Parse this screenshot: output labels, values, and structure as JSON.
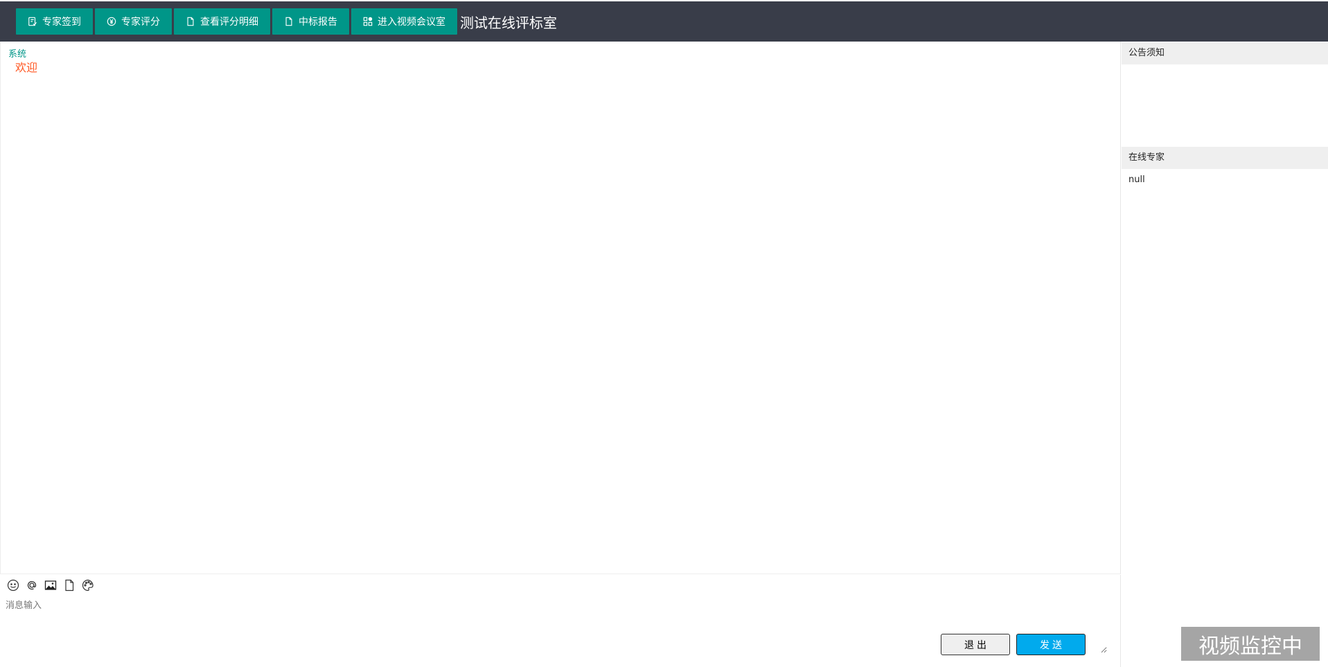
{
  "topbar": {
    "buttons": [
      {
        "label": "专家签到",
        "icon": "sign-in-icon"
      },
      {
        "label": "专家评分",
        "icon": "yen-icon"
      },
      {
        "label": "查看评分明细",
        "icon": "file-icon"
      },
      {
        "label": "中标报告",
        "icon": "file-icon"
      },
      {
        "label": "进入视频会议室",
        "icon": "apps-icon"
      }
    ],
    "title": "测试在线评标室"
  },
  "chat": {
    "messages": [
      {
        "sender": "系统",
        "text": "欢迎"
      }
    ]
  },
  "composer": {
    "tools": [
      "smile-icon",
      "at-icon",
      "image-icon",
      "file-icon",
      "palette-icon"
    ],
    "placeholder": "消息输入",
    "exit_label": "退出",
    "send_label": "发送"
  },
  "right": {
    "notice_title": "公告须知",
    "online_title": "在线专家",
    "online_experts": [
      "null"
    ]
  },
  "monitor_label": "视频监控中",
  "colors": {
    "topbar_bg": "#393d49",
    "button_bg": "#009688",
    "sender": "#009688",
    "message": "#ff5722",
    "send_button": "#01aaed",
    "monitor_bg": "#a5a5a5"
  }
}
